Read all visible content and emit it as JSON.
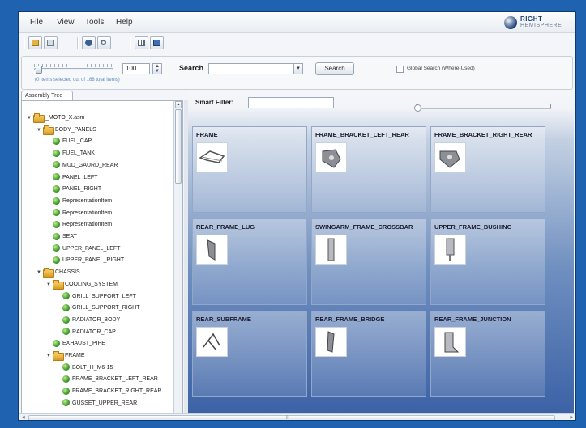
{
  "menu": {
    "items": [
      "File",
      "View",
      "Tools",
      "Help"
    ]
  },
  "logo": {
    "line1": "RIGHT",
    "line2": "HEMISPHERE"
  },
  "toolbar": {
    "icons": [
      "folder-open-icon",
      "print-icon",
      "settings-icon",
      "find-icon",
      "grid-view-icon",
      "monitor-icon"
    ]
  },
  "search_panel": {
    "count_value": "100",
    "selection_info": "(0 items selected  out of 168 total items)",
    "search_label": "Search",
    "search_value": "",
    "search_button": "Search",
    "global_search_label": "Global Search (Where-Used)"
  },
  "assembly_tab": {
    "label": "Assembly Tree"
  },
  "tree": {
    "rows": [
      {
        "label": "_MOTO_X.asm",
        "type": "folder",
        "expanded": true,
        "level": 0
      },
      {
        "label": "BODY_PANELS",
        "type": "folder",
        "expanded": true,
        "level": 1
      },
      {
        "label": "FUEL_CAP",
        "type": "part",
        "level": 2
      },
      {
        "label": "FUEL_TANK",
        "type": "part",
        "level": 2
      },
      {
        "label": "MUD_GAURD_REAR",
        "type": "part",
        "level": 2
      },
      {
        "label": "PANEL_LEFT",
        "type": "part",
        "level": 2
      },
      {
        "label": "PANEL_RIGHT",
        "type": "part",
        "level": 2
      },
      {
        "label": "RepresentationItem",
        "type": "part",
        "level": 2
      },
      {
        "label": "RepresentationItem",
        "type": "part",
        "level": 2
      },
      {
        "label": "RepresentationItem",
        "type": "part",
        "level": 2
      },
      {
        "label": "SEAT",
        "type": "part",
        "level": 2
      },
      {
        "label": "UPPER_PANEL_LEFT",
        "type": "part",
        "level": 2
      },
      {
        "label": "UPPER_PANEL_RIGHT",
        "type": "part",
        "level": 2
      },
      {
        "label": "CHASSIS",
        "type": "folder",
        "expanded": true,
        "level": 1
      },
      {
        "label": "COOLING_SYSTEM",
        "type": "folder",
        "expanded": true,
        "level": 2
      },
      {
        "label": "GRILL_SUPPORT_LEFT",
        "type": "part",
        "level": 3
      },
      {
        "label": "GRILL_SUPPORT_RIGHT",
        "type": "part",
        "level": 3
      },
      {
        "label": "RADIATOR_BODY",
        "type": "part",
        "level": 3
      },
      {
        "label": "RADIATOR_CAP",
        "type": "part",
        "level": 3
      },
      {
        "label": "EXHAUST_PIPE",
        "type": "part",
        "level": 2
      },
      {
        "label": "FRAME",
        "type": "folder",
        "expanded": true,
        "level": 2
      },
      {
        "label": "BOLT_H_M6-15",
        "type": "part",
        "level": 3
      },
      {
        "label": "FRAME_BRACKET_LEFT_REAR",
        "type": "part",
        "level": 3
      },
      {
        "label": "FRAME_BRACKET_RIGHT_REAR",
        "type": "part",
        "level": 3
      },
      {
        "label": "GUSSET_UPPER_REAR",
        "type": "part",
        "level": 3
      }
    ]
  },
  "smart_filter": {
    "label": "Smart Filter:",
    "value": ""
  },
  "cards": [
    {
      "title": "FRAME",
      "icon": "frame-thumbnail-icon"
    },
    {
      "title": "FRAME_BRACKET_LEFT_REAR",
      "icon": "bracket-left-thumbnail-icon"
    },
    {
      "title": "FRAME_BRACKET_RIGHT_REAR",
      "icon": "bracket-right-thumbnail-icon"
    },
    {
      "title": "REAR_FRAME_LUG",
      "icon": "lug-thumbnail-icon"
    },
    {
      "title": "SWINGARM_FRAME_CROSSBAR",
      "icon": "crossbar-thumbnail-icon"
    },
    {
      "title": "UPPER_FRAME_BUSHING",
      "icon": "bushing-thumbnail-icon"
    },
    {
      "title": "REAR_SUBFRAME",
      "icon": "subframe-thumbnail-icon"
    },
    {
      "title": "REAR_FRAME_BRIDGE",
      "icon": "bridge-thumbnail-icon"
    },
    {
      "title": "REAR_FRAME_JUNCTION",
      "icon": "junction-thumbnail-icon"
    }
  ]
}
